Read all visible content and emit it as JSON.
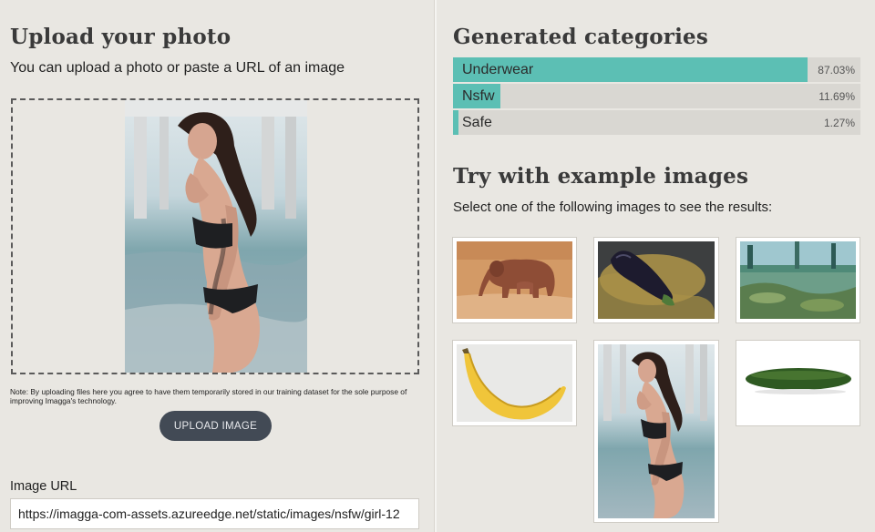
{
  "upload": {
    "title": "Upload your photo",
    "subtitle": "You can upload a photo or paste a URL of an image",
    "note": "Note: By uploading files here you agree to have them temporarily stored in our training dataset for the sole purpose of improving Imagga's technology.",
    "button_label": "UPLOAD IMAGE",
    "url_label": "Image URL",
    "url_value": "https://imagga-com-assets.azureedge.net/static/images/nsfw/girl-12"
  },
  "categories": {
    "title": "Generated categories",
    "items": [
      {
        "label": "Underwear",
        "percent": "87.03%",
        "fraction": 0.8703
      },
      {
        "label": "Nsfw",
        "percent": "11.69%",
        "fraction": 0.1169
      },
      {
        "label": "Safe",
        "percent": "1.27%",
        "fraction": 0.0127
      }
    ]
  },
  "examples": {
    "title": "Try with example images",
    "subtitle": "Select one of the following images to see the results:",
    "images": [
      "elephant",
      "eggplant",
      "landscape",
      "banana",
      "woman-at-beach",
      "cucumber"
    ]
  },
  "colors": {
    "accent": "#5cbfb4",
    "bar_track": "#d9d7d2",
    "button": "#424a55",
    "background": "#e9e7e2"
  }
}
